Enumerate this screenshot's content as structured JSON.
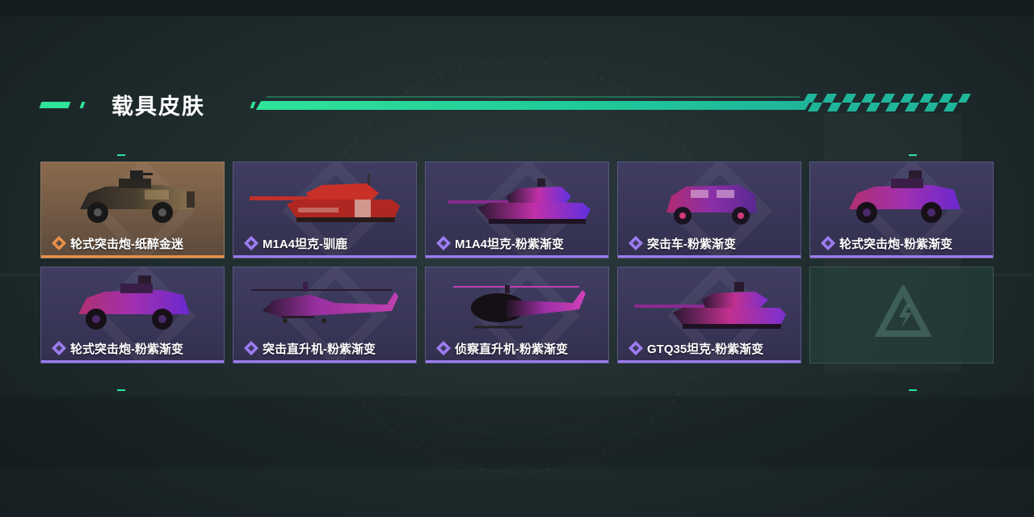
{
  "header": {
    "title": "载具皮肤"
  },
  "colors": {
    "accent": "#2fe39a",
    "purple_rank": "#9d7cf0",
    "orange_rank": "#e8914a"
  },
  "skins": [
    {
      "name": "轮式突击炮-纸醉金迷",
      "rarity": "orange",
      "vehicle": "armored-car",
      "scheme": "gold"
    },
    {
      "name": "M1A4坦克-驯鹿",
      "rarity": "purple",
      "vehicle": "tank",
      "scheme": "red"
    },
    {
      "name": "M1A4坦克-粉紫渐变",
      "rarity": "purple",
      "vehicle": "tank",
      "scheme": "pink"
    },
    {
      "name": "突击车-粉紫渐变",
      "rarity": "purple",
      "vehicle": "assault-car",
      "scheme": "pink"
    },
    {
      "name": "轮式突击炮-粉紫渐变",
      "rarity": "purple",
      "vehicle": "armored-car",
      "scheme": "pink"
    },
    {
      "name": "轮式突击炮-粉紫渐变",
      "rarity": "purple",
      "vehicle": "armored-car",
      "scheme": "pink"
    },
    {
      "name": "突击直升机-粉紫渐变",
      "rarity": "purple",
      "vehicle": "attack-helicopter",
      "scheme": "pink"
    },
    {
      "name": "侦察直升机-粉紫渐变",
      "rarity": "purple",
      "vehicle": "scout-helicopter",
      "scheme": "pink"
    },
    {
      "name": "GTQ35坦克-粉紫渐变",
      "rarity": "purple",
      "vehicle": "tank-long",
      "scheme": "pink"
    }
  ],
  "empty_slot": {
    "icon": "game-logo-icon"
  }
}
